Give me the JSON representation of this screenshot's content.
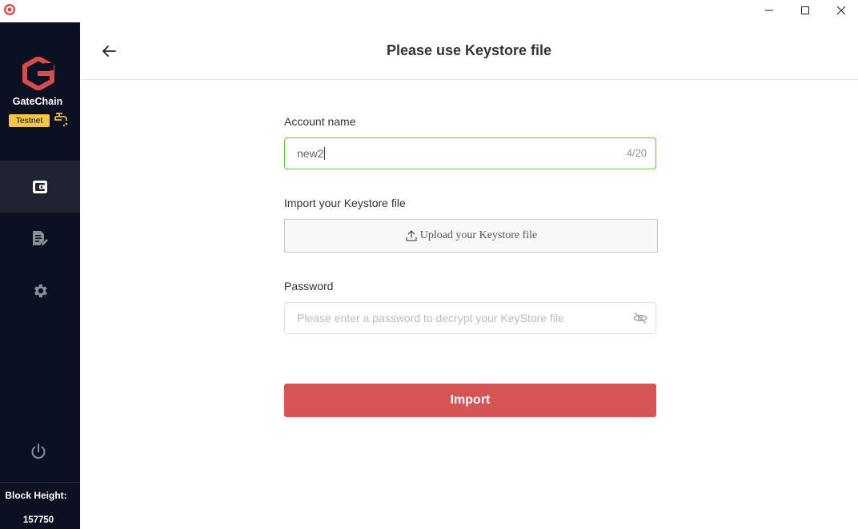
{
  "window": {
    "app_icon": "app-logo-icon",
    "controls": [
      "minimize-icon",
      "maximize-icon",
      "close-icon"
    ]
  },
  "sidebar": {
    "brand": "GateChain",
    "network_badge": "Testnet",
    "network_badge_color": "#f5c543",
    "nav_items": [
      "wallet-icon",
      "document-edit-icon",
      "gear-icon"
    ],
    "power_icon": "power-icon",
    "block_height_label": "Block Height:",
    "block_height_value": "157750"
  },
  "header": {
    "back_icon": "arrow-left-icon",
    "title": "Please use Keystore file"
  },
  "form": {
    "account_name_label": "Account name",
    "account_name_value": "new2",
    "account_name_counter": "4/20",
    "keystore_label": "Import your Keystore file",
    "upload_label": "Upload your Keystore file",
    "password_label": "Password",
    "password_placeholder": "Please enter a password to decrypt your KeyStore file",
    "import_button": "Import"
  },
  "colors": {
    "sidebar_bg": "#0b1023",
    "accent_red": "#d55555",
    "active_input_border": "#67c23a"
  }
}
